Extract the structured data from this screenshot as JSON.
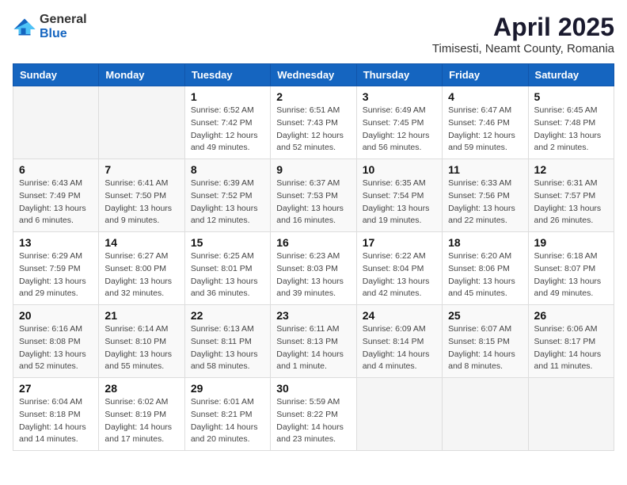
{
  "logo": {
    "general": "General",
    "blue": "Blue"
  },
  "header": {
    "title": "April 2025",
    "subtitle": "Timisesti, Neamt County, Romania"
  },
  "weekdays": [
    "Sunday",
    "Monday",
    "Tuesday",
    "Wednesday",
    "Thursday",
    "Friday",
    "Saturday"
  ],
  "weeks": [
    [
      {
        "day": "",
        "info": ""
      },
      {
        "day": "",
        "info": ""
      },
      {
        "day": "1",
        "info": "Sunrise: 6:52 AM\nSunset: 7:42 PM\nDaylight: 12 hours and 49 minutes."
      },
      {
        "day": "2",
        "info": "Sunrise: 6:51 AM\nSunset: 7:43 PM\nDaylight: 12 hours and 52 minutes."
      },
      {
        "day": "3",
        "info": "Sunrise: 6:49 AM\nSunset: 7:45 PM\nDaylight: 12 hours and 56 minutes."
      },
      {
        "day": "4",
        "info": "Sunrise: 6:47 AM\nSunset: 7:46 PM\nDaylight: 12 hours and 59 minutes."
      },
      {
        "day": "5",
        "info": "Sunrise: 6:45 AM\nSunset: 7:48 PM\nDaylight: 13 hours and 2 minutes."
      }
    ],
    [
      {
        "day": "6",
        "info": "Sunrise: 6:43 AM\nSunset: 7:49 PM\nDaylight: 13 hours and 6 minutes."
      },
      {
        "day": "7",
        "info": "Sunrise: 6:41 AM\nSunset: 7:50 PM\nDaylight: 13 hours and 9 minutes."
      },
      {
        "day": "8",
        "info": "Sunrise: 6:39 AM\nSunset: 7:52 PM\nDaylight: 13 hours and 12 minutes."
      },
      {
        "day": "9",
        "info": "Sunrise: 6:37 AM\nSunset: 7:53 PM\nDaylight: 13 hours and 16 minutes."
      },
      {
        "day": "10",
        "info": "Sunrise: 6:35 AM\nSunset: 7:54 PM\nDaylight: 13 hours and 19 minutes."
      },
      {
        "day": "11",
        "info": "Sunrise: 6:33 AM\nSunset: 7:56 PM\nDaylight: 13 hours and 22 minutes."
      },
      {
        "day": "12",
        "info": "Sunrise: 6:31 AM\nSunset: 7:57 PM\nDaylight: 13 hours and 26 minutes."
      }
    ],
    [
      {
        "day": "13",
        "info": "Sunrise: 6:29 AM\nSunset: 7:59 PM\nDaylight: 13 hours and 29 minutes."
      },
      {
        "day": "14",
        "info": "Sunrise: 6:27 AM\nSunset: 8:00 PM\nDaylight: 13 hours and 32 minutes."
      },
      {
        "day": "15",
        "info": "Sunrise: 6:25 AM\nSunset: 8:01 PM\nDaylight: 13 hours and 36 minutes."
      },
      {
        "day": "16",
        "info": "Sunrise: 6:23 AM\nSunset: 8:03 PM\nDaylight: 13 hours and 39 minutes."
      },
      {
        "day": "17",
        "info": "Sunrise: 6:22 AM\nSunset: 8:04 PM\nDaylight: 13 hours and 42 minutes."
      },
      {
        "day": "18",
        "info": "Sunrise: 6:20 AM\nSunset: 8:06 PM\nDaylight: 13 hours and 45 minutes."
      },
      {
        "day": "19",
        "info": "Sunrise: 6:18 AM\nSunset: 8:07 PM\nDaylight: 13 hours and 49 minutes."
      }
    ],
    [
      {
        "day": "20",
        "info": "Sunrise: 6:16 AM\nSunset: 8:08 PM\nDaylight: 13 hours and 52 minutes."
      },
      {
        "day": "21",
        "info": "Sunrise: 6:14 AM\nSunset: 8:10 PM\nDaylight: 13 hours and 55 minutes."
      },
      {
        "day": "22",
        "info": "Sunrise: 6:13 AM\nSunset: 8:11 PM\nDaylight: 13 hours and 58 minutes."
      },
      {
        "day": "23",
        "info": "Sunrise: 6:11 AM\nSunset: 8:13 PM\nDaylight: 14 hours and 1 minute."
      },
      {
        "day": "24",
        "info": "Sunrise: 6:09 AM\nSunset: 8:14 PM\nDaylight: 14 hours and 4 minutes."
      },
      {
        "day": "25",
        "info": "Sunrise: 6:07 AM\nSunset: 8:15 PM\nDaylight: 14 hours and 8 minutes."
      },
      {
        "day": "26",
        "info": "Sunrise: 6:06 AM\nSunset: 8:17 PM\nDaylight: 14 hours and 11 minutes."
      }
    ],
    [
      {
        "day": "27",
        "info": "Sunrise: 6:04 AM\nSunset: 8:18 PM\nDaylight: 14 hours and 14 minutes."
      },
      {
        "day": "28",
        "info": "Sunrise: 6:02 AM\nSunset: 8:19 PM\nDaylight: 14 hours and 17 minutes."
      },
      {
        "day": "29",
        "info": "Sunrise: 6:01 AM\nSunset: 8:21 PM\nDaylight: 14 hours and 20 minutes."
      },
      {
        "day": "30",
        "info": "Sunrise: 5:59 AM\nSunset: 8:22 PM\nDaylight: 14 hours and 23 minutes."
      },
      {
        "day": "",
        "info": ""
      },
      {
        "day": "",
        "info": ""
      },
      {
        "day": "",
        "info": ""
      }
    ]
  ]
}
